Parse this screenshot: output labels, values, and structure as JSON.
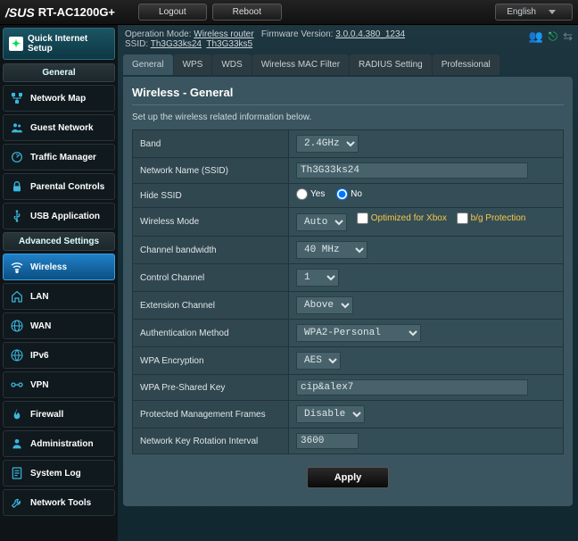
{
  "top": {
    "brand": "/SUS",
    "model": "RT-AC1200G+",
    "logout": "Logout",
    "reboot": "Reboot",
    "lang": "English"
  },
  "info": {
    "op_mode_label": "Operation Mode:",
    "op_mode": "Wireless router",
    "fw_label": "Firmware Version:",
    "fw": "3.0.0.4.380_1234",
    "ssid_label": "SSID:",
    "ssid1": "Th3G33ks24",
    "ssid2": "Th3G33ks5"
  },
  "sidebar": {
    "qis": "Quick Internet\nSetup",
    "general_head": "General",
    "adv_head": "Advanced Settings",
    "general": [
      {
        "label": "Network Map",
        "icon": "netmap"
      },
      {
        "label": "Guest Network",
        "icon": "guest"
      },
      {
        "label": "Traffic Manager",
        "icon": "traffic"
      },
      {
        "label": "Parental Controls",
        "icon": "lock"
      },
      {
        "label": "USB Application",
        "icon": "usb"
      }
    ],
    "adv": [
      {
        "label": "Wireless",
        "icon": "wifi",
        "active": true
      },
      {
        "label": "LAN",
        "icon": "home"
      },
      {
        "label": "WAN",
        "icon": "globe"
      },
      {
        "label": "IPv6",
        "icon": "ipv6"
      },
      {
        "label": "VPN",
        "icon": "vpn"
      },
      {
        "label": "Firewall",
        "icon": "fire"
      },
      {
        "label": "Administration",
        "icon": "admin"
      },
      {
        "label": "System Log",
        "icon": "log"
      },
      {
        "label": "Network Tools",
        "icon": "tools"
      }
    ]
  },
  "tabs": [
    "General",
    "WPS",
    "WDS",
    "Wireless MAC Filter",
    "RADIUS Setting",
    "Professional"
  ],
  "panel": {
    "title": "Wireless - General",
    "desc": "Set up the wireless related information below.",
    "rows": {
      "band_l": "Band",
      "band_v": "2.4GHz",
      "ssid_l": "Network Name (SSID)",
      "ssid_v": "Th3G33ks24",
      "hide_l": "Hide SSID",
      "hide_yes": "Yes",
      "hide_no": "No",
      "mode_l": "Wireless Mode",
      "mode_v": "Auto",
      "mode_xbox": "Optimized for Xbox",
      "mode_bg": "b/g Protection",
      "bw_l": "Channel bandwidth",
      "bw_v": "40 MHz",
      "ctrl_l": "Control Channel",
      "ctrl_v": "1",
      "ext_l": "Extension Channel",
      "ext_v": "Above",
      "auth_l": "Authentication Method",
      "auth_v": "WPA2-Personal",
      "enc_l": "WPA Encryption",
      "enc_v": "AES",
      "psk_l": "WPA Pre-Shared Key",
      "psk_v": "cip&alex7",
      "pmf_l": "Protected Management Frames",
      "pmf_v": "Disable",
      "rot_l": "Network Key Rotation Interval",
      "rot_v": "3600"
    },
    "apply": "Apply"
  }
}
